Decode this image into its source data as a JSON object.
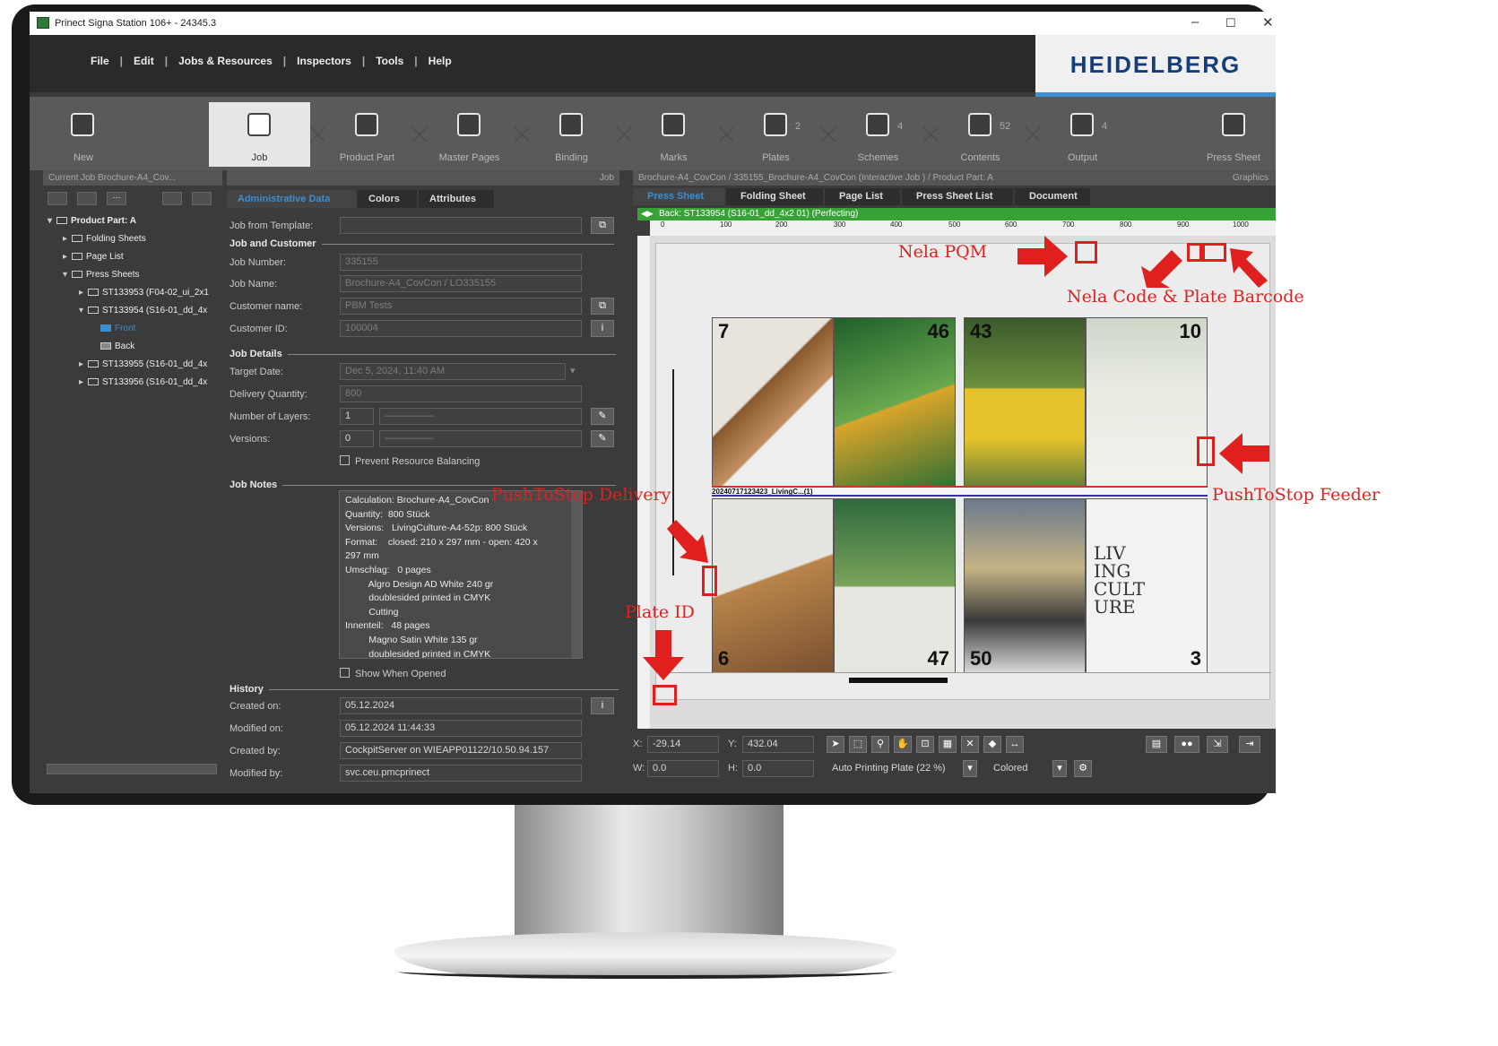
{
  "window": {
    "title": "Prinect Signa Station 106+  - 24345.3"
  },
  "menu": [
    "File",
    "Edit",
    "Jobs & Resources",
    "Inspectors",
    "Tools",
    "Help"
  ],
  "logo": "HEIDELBERG",
  "workflow": [
    {
      "label": "New",
      "count": ""
    },
    {
      "label": "Job",
      "count": ""
    },
    {
      "label": "Product Part",
      "count": ""
    },
    {
      "label": "Master Pages",
      "count": ""
    },
    {
      "label": "Binding",
      "count": ""
    },
    {
      "label": "Marks",
      "count": ""
    },
    {
      "label": "Plates",
      "count": "2"
    },
    {
      "label": "Schemes",
      "count": "4"
    },
    {
      "label": "Contents",
      "count": "52"
    },
    {
      "label": "Output",
      "count": "4"
    },
    {
      "label": "Press Sheet",
      "count": ""
    }
  ],
  "left_panel": {
    "header": "Current Job Brochure-A4_Cov...",
    "tree": [
      {
        "label": "Product Part: A",
        "indent": 0
      },
      {
        "label": "Folding Sheets",
        "indent": 1
      },
      {
        "label": "Page List",
        "indent": 1
      },
      {
        "label": "Press Sheets",
        "indent": 1
      },
      {
        "label": "ST133953 (F04-02_ui_2x1",
        "indent": 2
      },
      {
        "label": "ST133954 (S16-01_dd_4x",
        "indent": 2
      },
      {
        "label": "Front",
        "indent": 3
      },
      {
        "label": "Back",
        "indent": 3
      },
      {
        "label": "ST133955 (S16-01_dd_4x",
        "indent": 2
      },
      {
        "label": "ST133956 (S16-01_dd_4x",
        "indent": 2
      }
    ]
  },
  "job_panel": {
    "header": "Job",
    "tabs": [
      "Administrative Data",
      "Colors",
      "Attributes"
    ],
    "job_from_template_label": "Job from Template:",
    "job_from_template": "",
    "section_job_customer": "Job and Customer",
    "job_number_label": "Job Number:",
    "job_number": "335155",
    "job_name_label": "Job Name:",
    "job_name": "Brochure-A4_CovCon / LO335155",
    "customer_name_label": "Customer name:",
    "customer_name": "PBM Tests",
    "customer_id_label": "Customer ID:",
    "customer_id": "100004",
    "section_job_details": "Job Details",
    "target_date_label": "Target Date:",
    "target_date": "Dec 5, 2024, 11:40 AM",
    "delivery_quantity_label": "Delivery Quantity:",
    "delivery_quantity": "800",
    "layers_label": "Number of Layers:",
    "layers": "1",
    "versions_label": "Versions:",
    "versions": "0",
    "prevent_balancing": "Prevent Resource Balancing",
    "section_job_notes": "Job Notes",
    "notes": "Calculation: Brochure-A4_CovCon\nQuantity:  800 Stück\nVersions:   LivingCulture-A4-52p: 800 Stück\nFormat:    closed: 210 x 297 mm - open: 420 x\n297 mm\nUmschlag:   0 pages\n         Algro Design AD White 240 gr\n         doublesided printed in CMYK\n         Cutting\nInnenteil:   48 pages\n         Magno Satin White 135 gr\n         doublesided printed in CMYK",
    "show_when_opened": "Show When Opened",
    "section_history": "History",
    "created_on_label": "Created on:",
    "created_on": "05.12.2024",
    "modified_on_label": "Modified on:",
    "modified_on": "05.12.2024  11:44:33",
    "created_by_label": "Created by:",
    "created_by": "CockpitServer on WIEAPP01122/10.50.94.157",
    "modified_by_label": "Modified by:",
    "modified_by": "svc.ceu.pmcprinect"
  },
  "viewer": {
    "header": "Brochure-A4_CovCon / 335155_Brochure-A4_CovCon (Interactive Job ) / Product Part: A",
    "header_right": "Graphics",
    "tabs": [
      "Press Sheet",
      "Folding Sheet",
      "Page List",
      "Press Sheet List",
      "Document"
    ],
    "status": "Back: ST133954 (S16-01_dd_4x2 01) (Perfecting)",
    "ruler_ticks": [
      "0",
      "100",
      "200",
      "300",
      "400",
      "500",
      "600",
      "700",
      "800",
      "900",
      "1000"
    ],
    "pages_top": [
      "7",
      "46",
      "43",
      "10"
    ],
    "pages_bottom": [
      "6",
      "47",
      "50",
      "3"
    ],
    "slug_text": "20240717123423_LivingC...(1)",
    "x_label": "X:",
    "x_value": "-29.14",
    "y_label": "Y:",
    "y_value": "432.04",
    "w_label": "W:",
    "w_value": "0.0",
    "h_label": "H:",
    "h_value": "0.0",
    "plate_select": "Auto Printing Plate (22 %)",
    "color_select": "Colored",
    "cover_text": "LIV ING CULT URE"
  },
  "annotations": {
    "nela_pqm": "Nela PQM",
    "nela_code": "Nela Code & Plate Barcode",
    "pts_delivery": "PushToStop Delivery",
    "pts_feeder": "PushToStop Feeder",
    "plate_id": "Plate ID",
    "color": "#e0201e"
  }
}
